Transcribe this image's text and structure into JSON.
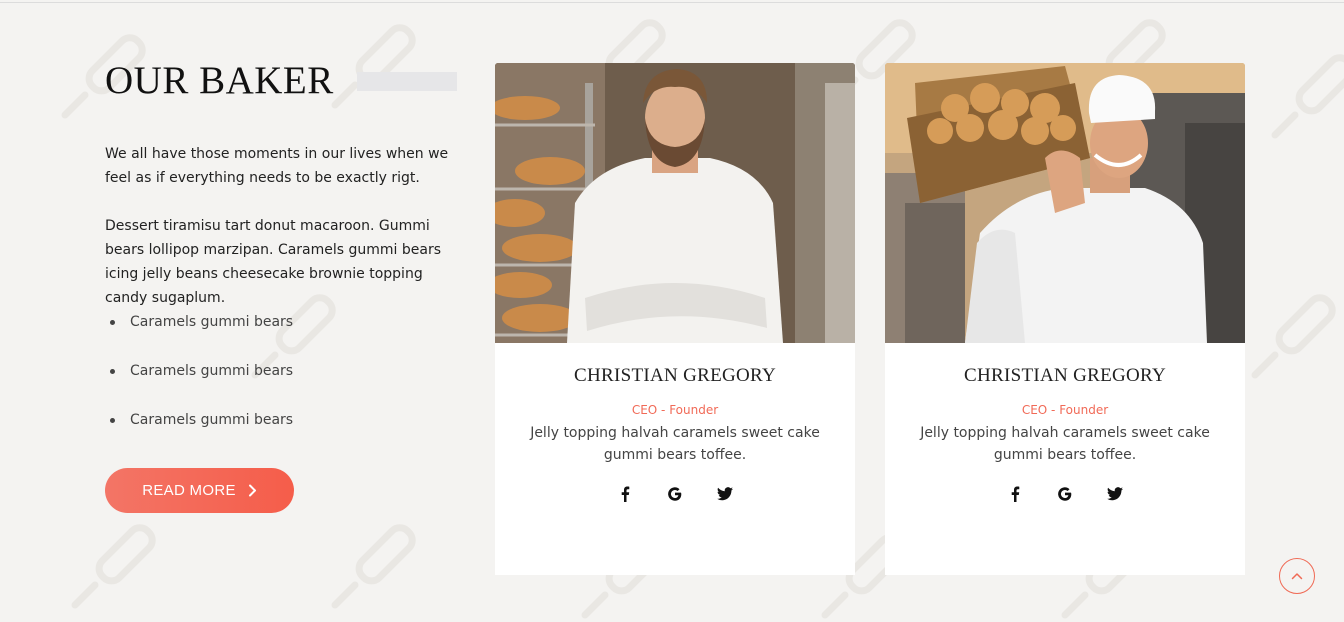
{
  "section": {
    "title": "OUR BAKER",
    "intro": "We all have those moments in our lives when we feel as if everything needs to be exactly rigt.",
    "body": "Dessert tiramisu tart donut macaroon. Gummi bears lollipop marzipan. Caramels gummi bears icing jelly beans cheesecake brownie topping candy sugaplum.",
    "bullets": [
      "Caramels gummi bears",
      "Caramels gummi bears",
      "Caramels gummi bears"
    ],
    "read_more_label": "READ MORE"
  },
  "team": [
    {
      "name": "CHRISTIAN GREGORY",
      "role": "CEO - Founder",
      "description": "Jelly topping halvah caramels sweet cake gummi bears toffee.",
      "photo": "bearded baker in white chef coat, arms crossed, bread racks behind"
    },
    {
      "name": "CHRISTIAN GREGORY",
      "role": "CEO - Founder",
      "description": "Jelly topping halvah caramels sweet cake gummi bears toffee.",
      "photo": "smiling baker in chef hat carrying wicker basket of buns"
    }
  ],
  "social_icons": [
    "facebook-icon",
    "google-icon",
    "twitter-icon"
  ],
  "colors": {
    "accent": "#f16a57",
    "background": "#f4f3f1",
    "card": "#ffffff",
    "title": "#111111"
  }
}
